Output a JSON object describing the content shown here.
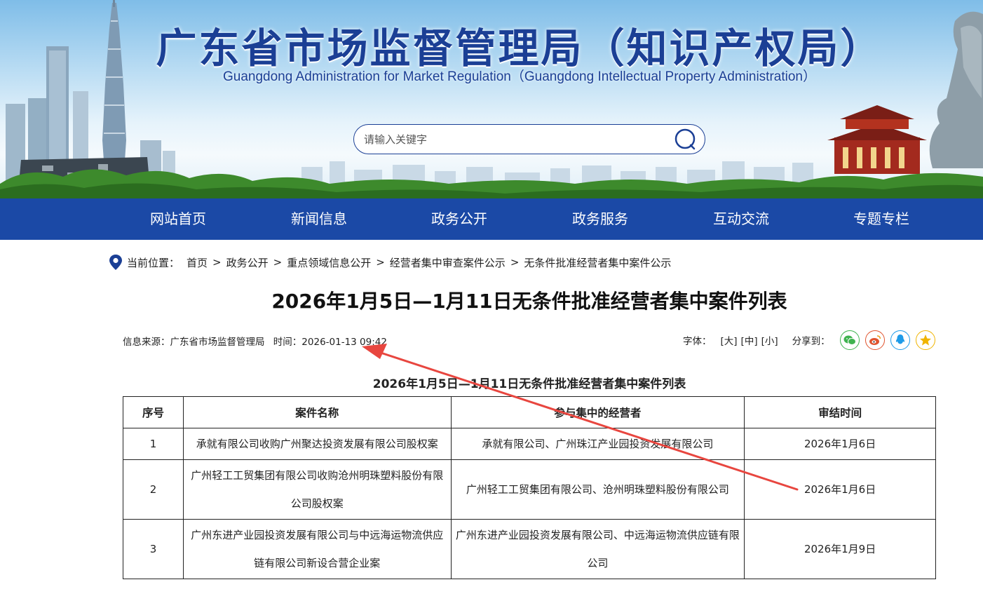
{
  "header": {
    "title": "广东省市场监督管理局（知识产权局）",
    "subtitle": "Guangdong Administration for Market Regulation（Guangdong Intellectual Property Administration）",
    "search": {
      "placeholder": "请输入关键字",
      "icon": "search-icon"
    }
  },
  "nav": {
    "items": [
      {
        "label": "网站首页"
      },
      {
        "label": "新闻信息"
      },
      {
        "label": "政务公开"
      },
      {
        "label": "政务服务"
      },
      {
        "label": "互动交流"
      },
      {
        "label": "专题专栏"
      }
    ]
  },
  "breadcrumb": {
    "prefix": "当前位置：",
    "separator": ">",
    "items": [
      "首页",
      "政务公开",
      "重点领域信息公开",
      "经营者集中审查案件公示",
      "无条件批准经营者集中案件公示"
    ]
  },
  "article": {
    "title": "2026年1月5日—1月11日无条件批准经营者集中案件列表",
    "source": "信息来源：广东省市场监督管理局",
    "time": "时间：2026-01-13 09:42",
    "font_label": "字体：",
    "font_sizes": [
      "[大]",
      "[中]",
      "[小]"
    ],
    "share_label": "分享到：",
    "share_icons": [
      {
        "name": "wechat-icon",
        "color": "#3fb34f"
      },
      {
        "name": "weibo-icon",
        "color": "#e0542e"
      },
      {
        "name": "qq-icon",
        "color": "#1e9be8"
      },
      {
        "name": "qzone-icon",
        "color": "#f0b400"
      }
    ]
  },
  "table": {
    "caption": "2026年1月5日—1月11日无条件批准经营者集中案件列表",
    "headers": [
      "序号",
      "案件名称",
      "参与集中的经营者",
      "审结时间"
    ],
    "rows": [
      [
        "1",
        "承就有限公司收购广州聚达投资发展有限公司股权案",
        "承就有限公司、广州珠江产业园投资发展有限公司",
        "2026年1月6日"
      ],
      [
        "2",
        "广州轻工工贸集团有限公司收购沧州明珠塑料股份有限公司股权案",
        "广州轻工工贸集团有限公司、沧州明珠塑料股份有限公司",
        "2026年1月6日"
      ],
      [
        "3",
        "广州东进产业园投资发展有限公司与中远海运物流供应链有限公司新设合营企业案",
        "广州东进产业园投资发展有限公司、中远海运物流供应链有限公司",
        "2026年1月9日"
      ]
    ]
  },
  "colors": {
    "brand": "#1b3f95",
    "nav_bg": "#1b49a6",
    "annotation": "#e8463f"
  }
}
